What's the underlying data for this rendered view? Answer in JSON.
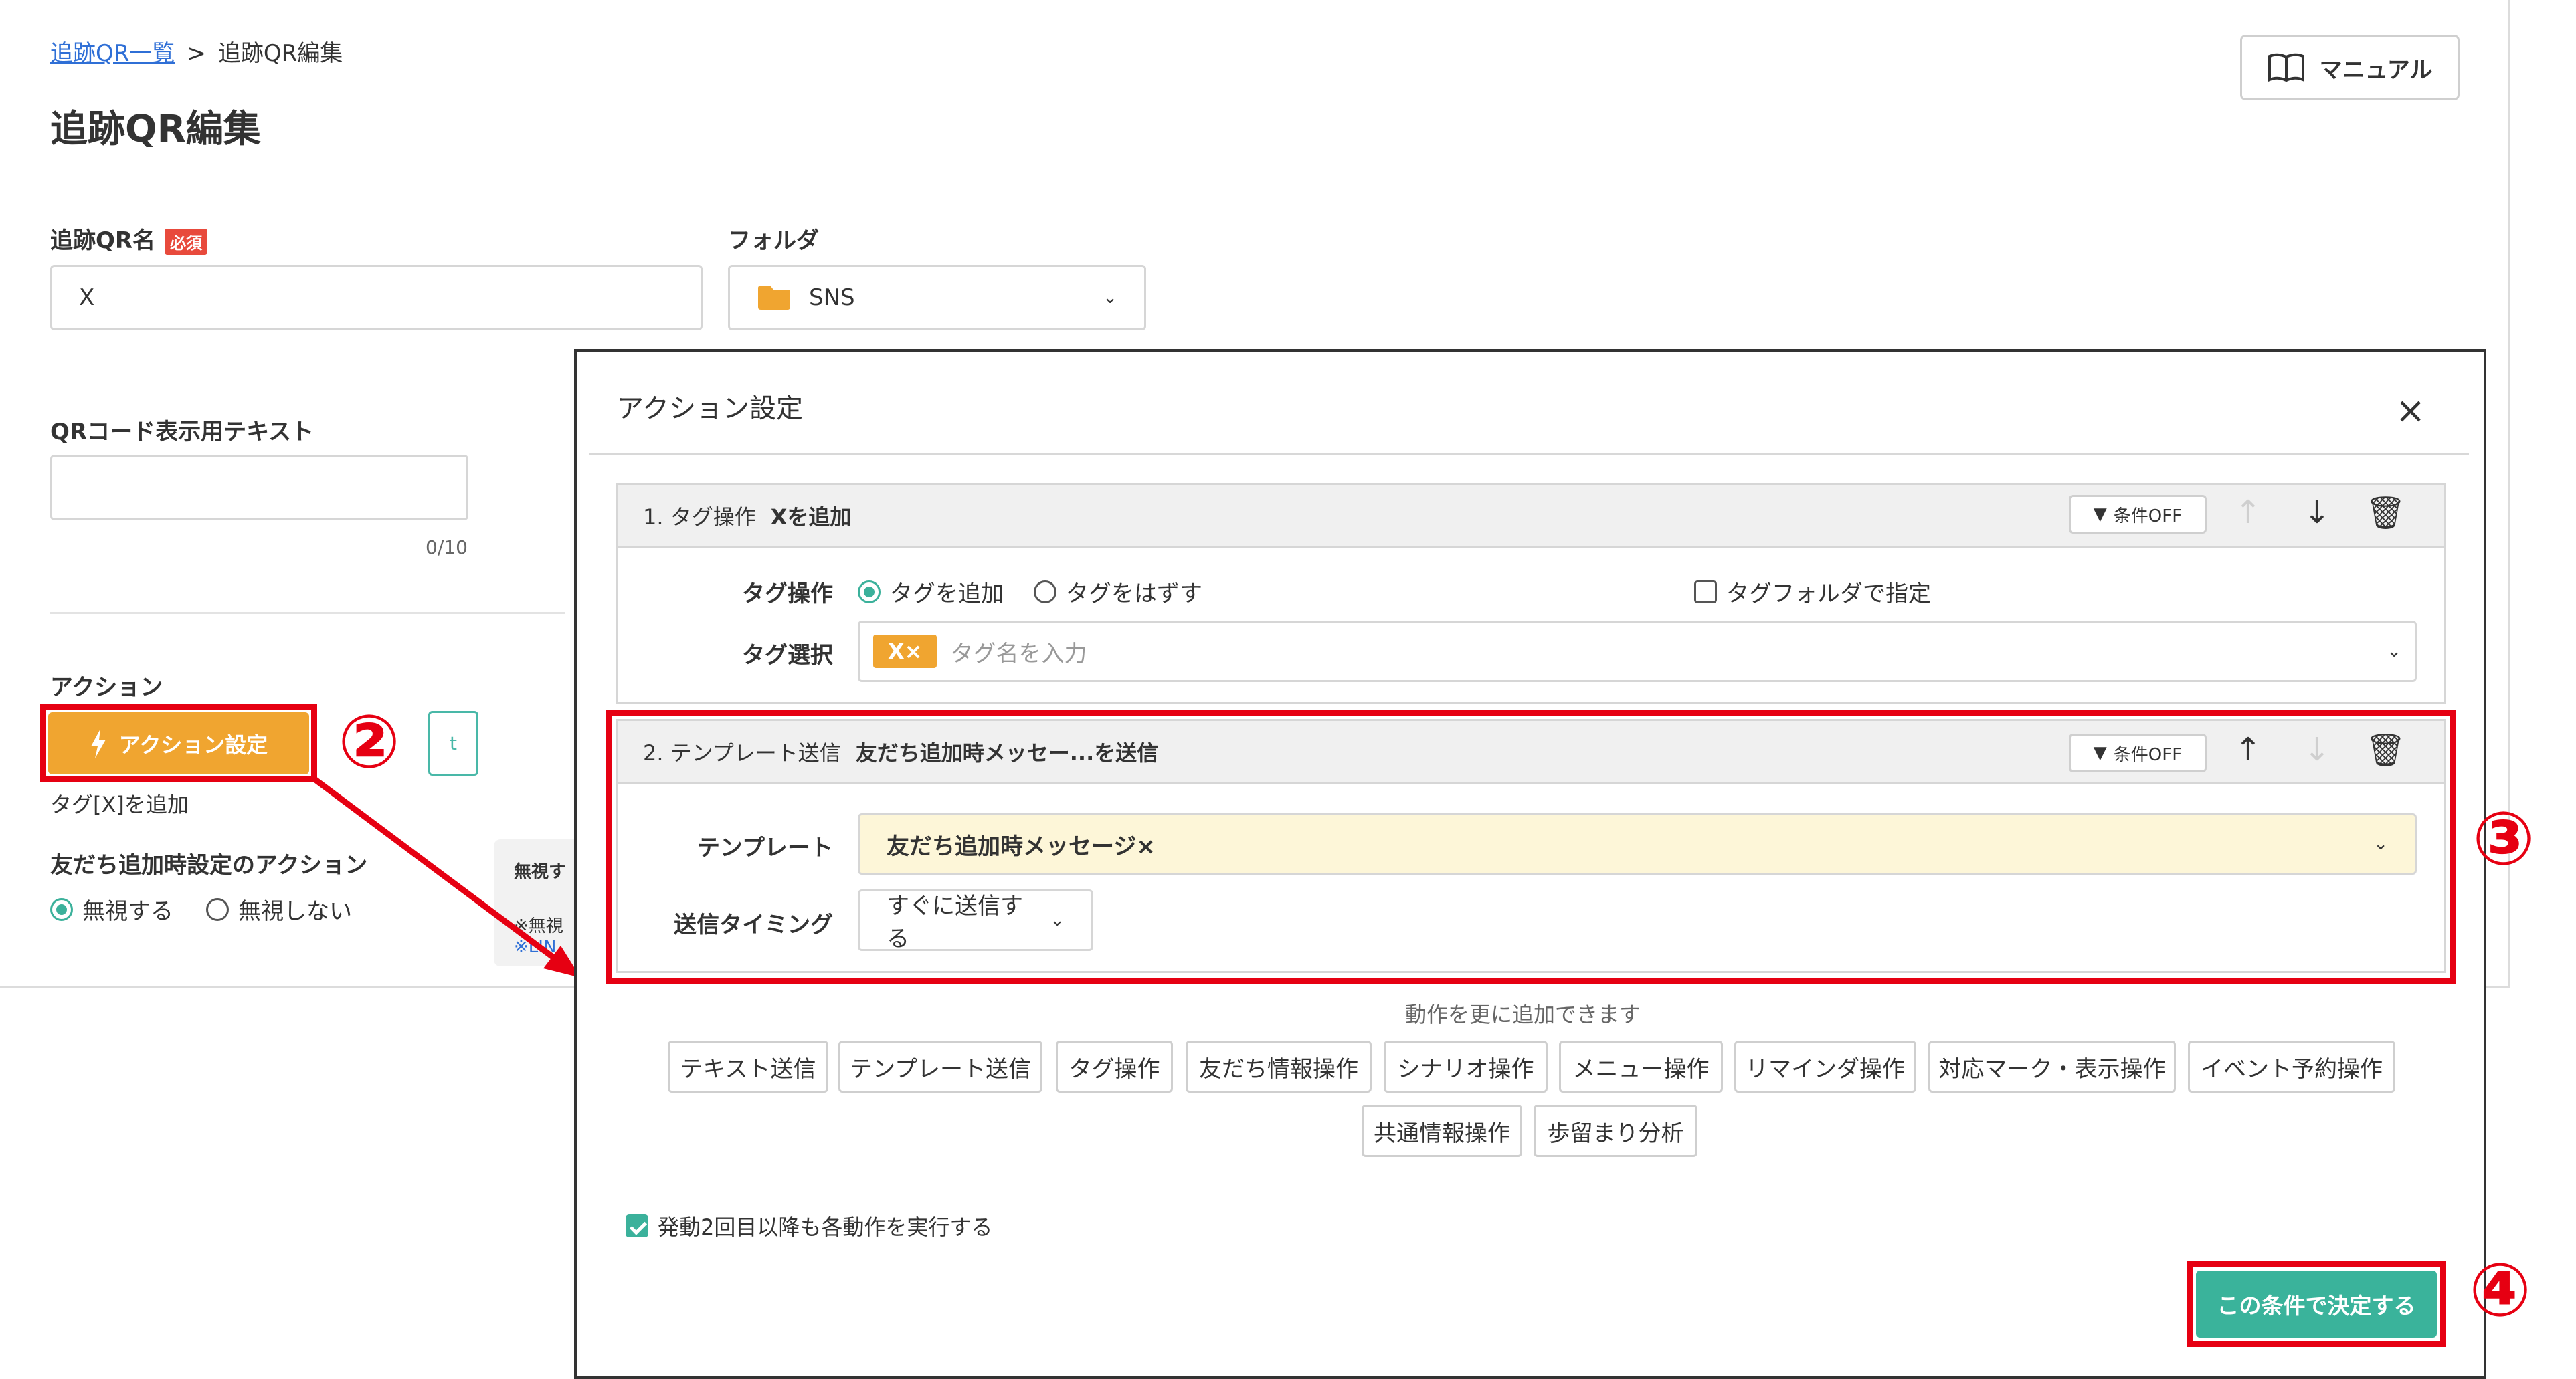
{
  "breadcrumb": {
    "parent": "追跡QR一覧",
    "separator": ">",
    "current": "追跡QR編集"
  },
  "page": {
    "title": "追跡QR編集"
  },
  "manual_button": {
    "label": "マニュアル",
    "icon": "book-icon"
  },
  "form": {
    "qr_name": {
      "label": "追跡QR名",
      "required_badge": "必須",
      "value": "X"
    },
    "folder": {
      "label": "フォルダ",
      "value": "SNS",
      "icon": "folder-icon"
    },
    "qr_display_text": {
      "label": "QRコード表示用テキスト",
      "value": "",
      "counter": "0/10"
    },
    "action": {
      "label": "アクション",
      "button_label": "アクション設定",
      "ghost_button_text": "t",
      "summary": "タグ[X]を追加"
    },
    "friend_add_action": {
      "label": "友だち追加時設定のアクション",
      "options": [
        "無視する",
        "無視しない"
      ],
      "selected": "無視する"
    },
    "info_box": {
      "line1": "無視す",
      "line2": "※無視",
      "line3": "※LIN"
    }
  },
  "annotations": {
    "step2": "②",
    "step3": "③",
    "step4": "④",
    "accent_color": "#e60012"
  },
  "modal": {
    "title": "アクション設定",
    "close_icon": "close-icon",
    "card1": {
      "index": "1. タグ操作",
      "title": "Xを追加",
      "cond_button": "条件OFF",
      "tag_operation_label": "タグ操作",
      "options": [
        "タグを追加",
        "タグをはずす"
      ],
      "selected": "タグを追加",
      "folder_checkbox_label": "タグフォルダで指定",
      "tag_select_label": "タグ選択",
      "chip": "X×",
      "placeholder": "タグ名を入力"
    },
    "card2": {
      "index": "2. テンプレート送信",
      "title": "友だち追加時メッセー...を送信",
      "cond_button": "条件OFF",
      "template_label": "テンプレート",
      "template_value": "友だち追加時メッセージ×",
      "timing_label": "送信タイミング",
      "timing_value": "すぐに送信する"
    },
    "add_hint": "動作を更に追加できます",
    "add_buttons_row1": [
      "テキスト送信",
      "テンプレート送信",
      "タグ操作",
      "友だち情報操作",
      "シナリオ操作",
      "メニュー操作",
      "リマインダ操作",
      "対応マーク・表示操作",
      "イベント予約操作"
    ],
    "add_buttons_row2": [
      "共通情報操作",
      "歩留まり分析"
    ],
    "repeat_checkbox_label": "発動2回目以降も各動作を実行する",
    "confirm_button": "この条件で決定する"
  }
}
